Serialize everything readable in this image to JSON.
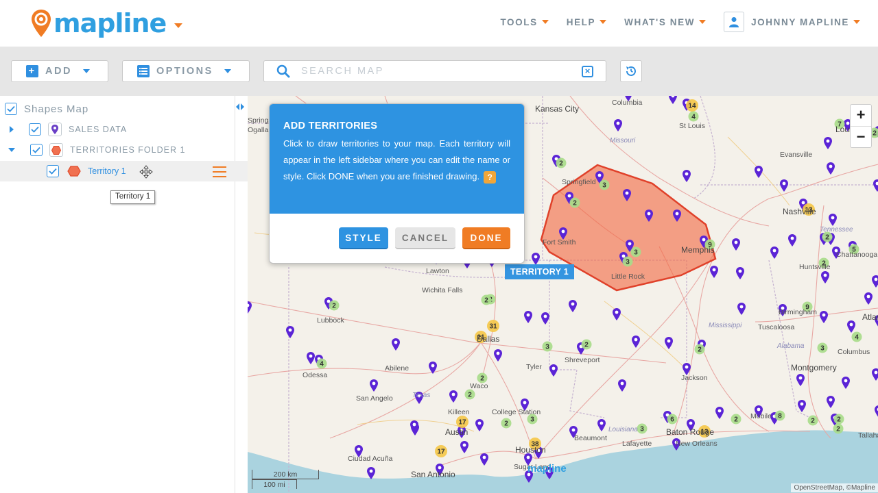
{
  "header": {
    "logo_text": "mapline",
    "nav": [
      {
        "label": "TOOLS"
      },
      {
        "label": "HELP"
      },
      {
        "label": "WHAT'S NEW"
      }
    ],
    "user_name": "JOHNNY MAPLINE"
  },
  "toolbar": {
    "add_label": "ADD",
    "options_label": "OPTIONS",
    "search_placeholder": "SEARCH MAP"
  },
  "sidebar": {
    "title": "Shapes Map",
    "layers": [
      {
        "label": "SALES DATA"
      },
      {
        "label": "TERRITORIES FOLDER 1"
      }
    ],
    "territory": {
      "label": "Territory 1"
    },
    "tooltip": "Territory 1"
  },
  "dialog": {
    "title": "ADD TERRITORIES",
    "text": "Click to draw territories to your map. Each territory will appear in the left sidebar where you can edit the name or style. Click DONE when you are finished drawing.",
    "help": "?",
    "style_label": "STYLE",
    "cancel_label": "CANCEL",
    "done_label": "DONE"
  },
  "map": {
    "territory_tag": "TERRITORY 1",
    "zoom_in": "+",
    "zoom_out": "−",
    "scale_km": "200 km",
    "scale_mi": "100 mi",
    "attribution": "OpenStreetMap, ©Mapline",
    "watermark": "mapline",
    "cities": [
      {
        "name": "Kansas City"
      },
      {
        "name": "Columbia"
      },
      {
        "name": "St Louis"
      },
      {
        "name": "Louisville"
      },
      {
        "name": "Missouri"
      },
      {
        "name": "Evansville"
      },
      {
        "name": "Springfield"
      },
      {
        "name": "Nashville"
      },
      {
        "name": "Tennessee"
      },
      {
        "name": "Fort Smith"
      },
      {
        "name": "Memphis"
      },
      {
        "name": "Chattanooga"
      },
      {
        "name": "Little Rock"
      },
      {
        "name": "Huntsville"
      },
      {
        "name": "Lawton"
      },
      {
        "name": "Wichita Falls"
      },
      {
        "name": "Birmingham"
      },
      {
        "name": "Lubbock"
      },
      {
        "name": "Dallas"
      },
      {
        "name": "Tuscaloosa"
      },
      {
        "name": "Mississippi"
      },
      {
        "name": "Abilene"
      },
      {
        "name": "Shreveport"
      },
      {
        "name": "Alabama"
      },
      {
        "name": "Columbus"
      },
      {
        "name": "Odessa"
      },
      {
        "name": "Tyler"
      },
      {
        "name": "Jackson"
      },
      {
        "name": "Montgomery"
      },
      {
        "name": "San Angelo"
      },
      {
        "name": "Texas"
      },
      {
        "name": "Waco"
      },
      {
        "name": "Killeen"
      },
      {
        "name": "College Station"
      },
      {
        "name": "Austin"
      },
      {
        "name": "Beaumont"
      },
      {
        "name": "Louisiana"
      },
      {
        "name": "Lafayette"
      },
      {
        "name": "Baton Rouge"
      },
      {
        "name": "New Orleans"
      },
      {
        "name": "Mobile"
      },
      {
        "name": "Tallahassee"
      },
      {
        "name": "Houston"
      },
      {
        "name": "Ciudad Acuña"
      },
      {
        "name": "San Antonio"
      },
      {
        "name": "Sugar Land"
      },
      {
        "name": "Atlanta"
      },
      {
        "name": "Springs"
      },
      {
        "name": "Ogallala"
      }
    ],
    "clusters": [
      "14",
      "4",
      "7",
      "2",
      "2",
      "3",
      "2",
      "13",
      "9",
      "3",
      "3",
      "2",
      "5",
      "2",
      "31",
      "21",
      "2",
      "3",
      "9",
      "2",
      "4",
      "2",
      "3",
      "4",
      "2",
      "2",
      "17",
      "3",
      "2",
      "6",
      "13",
      "2",
      "8",
      "2",
      "2",
      "38",
      "17",
      "3",
      "2",
      "2",
      "2"
    ]
  }
}
